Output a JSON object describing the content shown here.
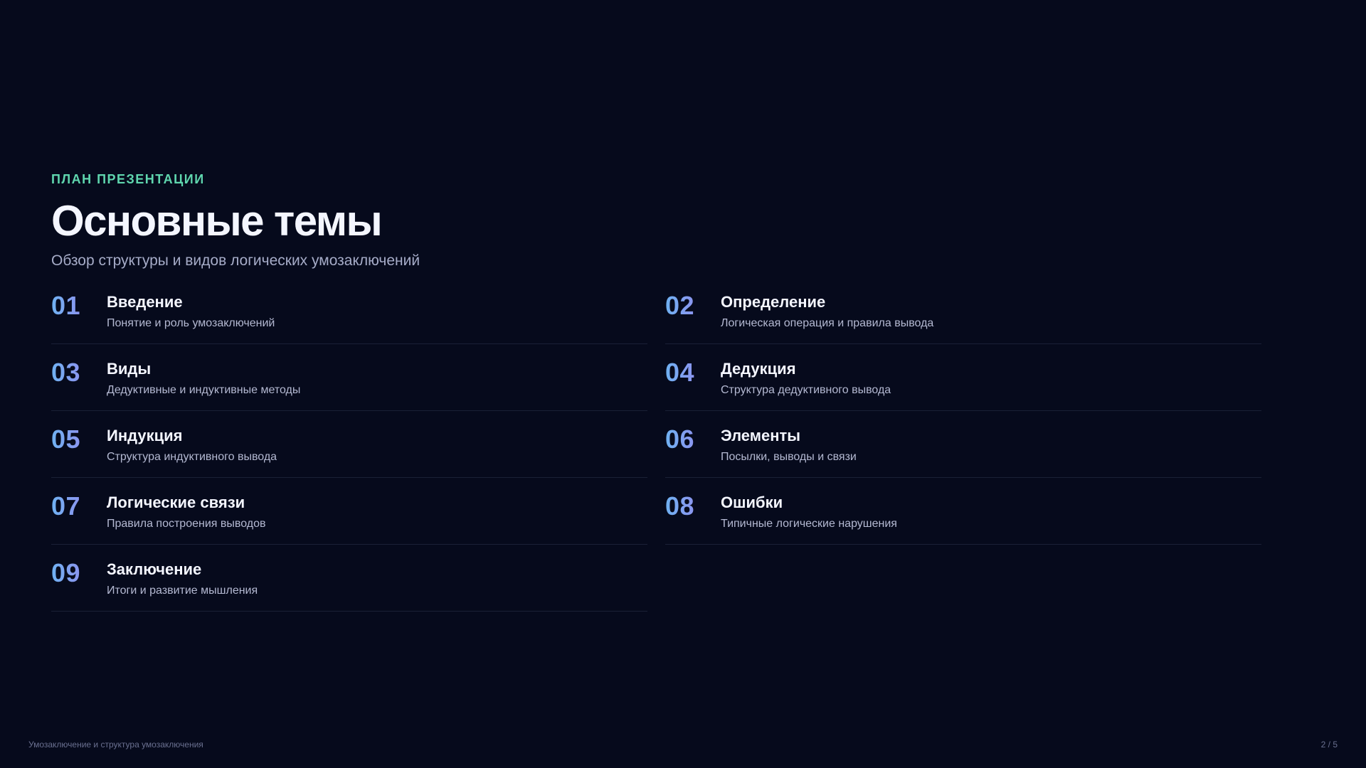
{
  "header": {
    "eyebrow": "ПЛАН ПРЕЗЕНТАЦИИ",
    "title": "Основные темы",
    "subtitle": "Обзор структуры и видов логических умозаключений"
  },
  "topics": [
    {
      "number": "01",
      "title": "Введение",
      "description": "Понятие и роль умозаключений"
    },
    {
      "number": "02",
      "title": "Определение",
      "description": "Логическая операция и правила вывода"
    },
    {
      "number": "03",
      "title": "Виды",
      "description": "Дедуктивные и индуктивные методы"
    },
    {
      "number": "04",
      "title": "Дедукция",
      "description": "Структура дедуктивного вывода"
    },
    {
      "number": "05",
      "title": "Индукция",
      "description": "Структура индуктивного вывода"
    },
    {
      "number": "06",
      "title": "Элементы",
      "description": "Посылки, выводы и связи"
    },
    {
      "number": "07",
      "title": "Логические связи",
      "description": "Правила построения выводов"
    },
    {
      "number": "08",
      "title": "Ошибки",
      "description": "Типичные логические нарушения"
    },
    {
      "number": "09",
      "title": "Заключение",
      "description": "Итоги и развитие мышления"
    }
  ],
  "footer": {
    "presentation_title": "Умозаключение и структура умозаключения",
    "page_indicator": "2 / 5"
  },
  "colors": {
    "background": "#060a1c",
    "accent_eyebrow": "#5fd6ae",
    "number_gradient_start": "#6fb2f2",
    "number_gradient_end": "#8b95f0"
  }
}
